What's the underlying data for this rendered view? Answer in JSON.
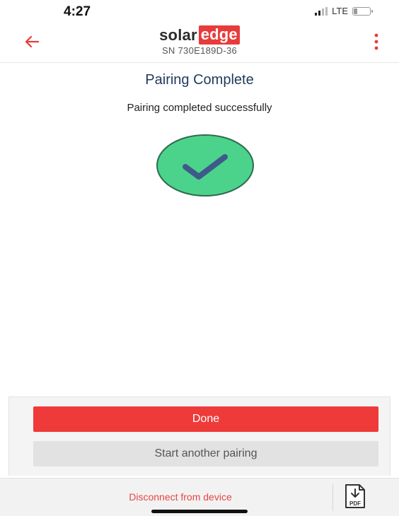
{
  "status_bar": {
    "time": "4:27",
    "network": "LTE",
    "icons": [
      "signal-icon",
      "battery-icon"
    ]
  },
  "header": {
    "logo_solar": "solar",
    "logo_edge": "edge",
    "serial": "SN 730E189D-36",
    "icons": [
      "back-arrow-icon",
      "more-vert-icon"
    ],
    "accent_color": "#e83b3b"
  },
  "main": {
    "title": "Pairing Complete",
    "message": "Pairing completed successfully",
    "status_icon": "check-circle-icon",
    "status_color": "#4bd38c"
  },
  "actions": {
    "done_label": "Done",
    "another_label": "Start another pairing",
    "done_color": "#ef3a3a"
  },
  "footer": {
    "disconnect_label": "Disconnect from device",
    "pdf_label": "PDF",
    "pdf_icon": "pdf-download-icon"
  }
}
